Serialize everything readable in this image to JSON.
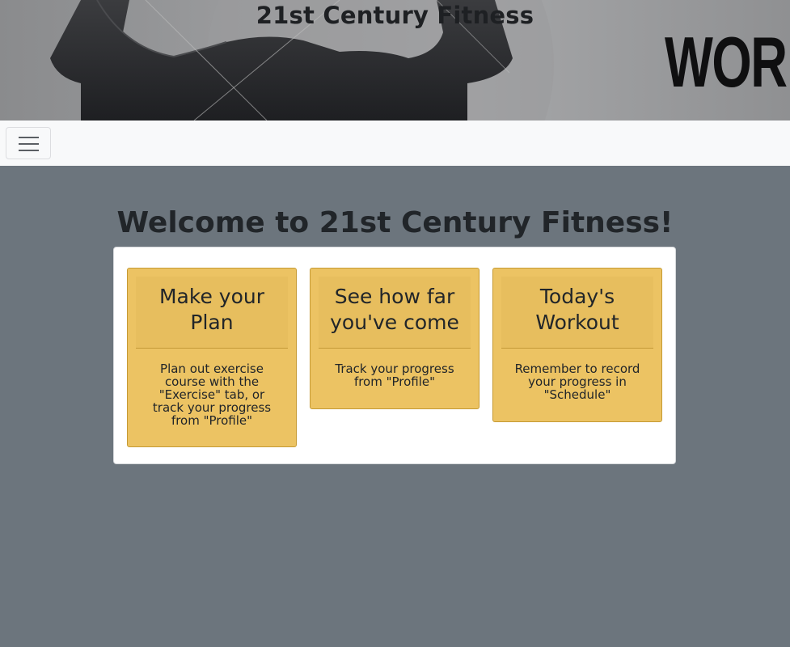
{
  "banner": {
    "title": "21st Century Fitness",
    "word": "WOR"
  },
  "navbar": {
    "toggler_icon": "hamburger-menu-icon"
  },
  "main": {
    "welcome": "Welcome to 21st Century Fitness!",
    "cards": [
      {
        "title": "Make your Plan",
        "text": "Plan out exercise course with the \"Exercise\" tab, or track your progress from \"Profile\""
      },
      {
        "title": "See how far you've come",
        "text": "Track your progress from \"Profile\""
      },
      {
        "title": "Today's Workout",
        "text": "Remember to record your progress in \"Schedule\""
      }
    ]
  },
  "colors": {
    "page_bg": "#6c757d",
    "navbar_bg": "#f8f9fa",
    "card_bg": "#ecc363",
    "card_border": "#c59a34"
  }
}
